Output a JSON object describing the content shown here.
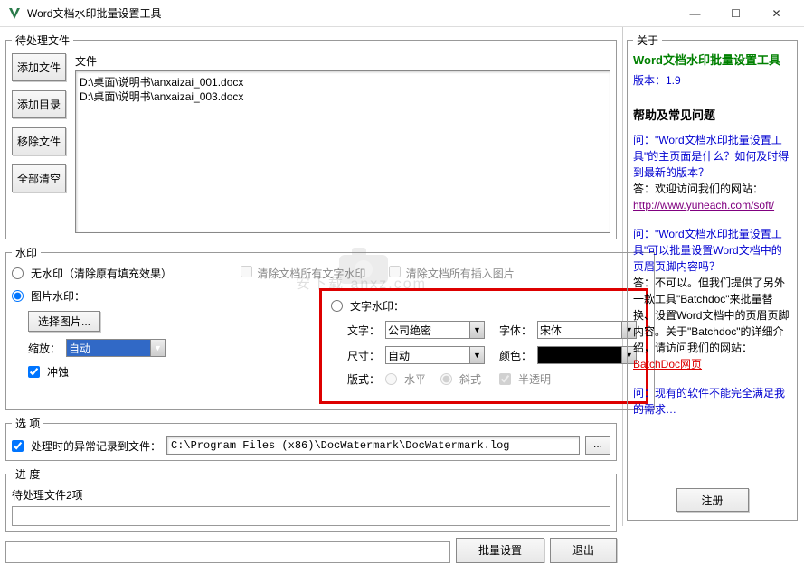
{
  "window": {
    "title": "Word文档水印批量设置工具",
    "min": "—",
    "max": "☐",
    "close": "✕"
  },
  "files_panel": {
    "legend": "待处理文件",
    "label": "文件",
    "add_file": "添加文件",
    "add_dir": "添加目录",
    "remove_file": "移除文件",
    "clear_all": "全部清空",
    "items": [
      "D:\\桌面\\说明书\\anxaizai_001.docx",
      "D:\\桌面\\说明书\\anxaizai_003.docx"
    ]
  },
  "watermark_panel": {
    "legend": "水印",
    "no_wm": "无水印（清除原有填充效果）",
    "clear_text": "清除文档所有文字水印",
    "clear_img": "清除文档所有插入图片",
    "pic_wm": "图片水印：",
    "select_pic": "选择图片...",
    "scale_label": "缩放：",
    "scale_value": "自动",
    "washout": "冲蚀",
    "text_wm": "文字水印：",
    "text_label": "文字：",
    "text_value": "公司绝密",
    "font_label": "字体：",
    "font_value": "宋体",
    "size_label": "尺寸：",
    "size_value": "自动",
    "color_label": "颜色：",
    "layout_label": "版式：",
    "layout_h": "水平",
    "layout_d": "斜式",
    "semitrans": "半透明"
  },
  "options_panel": {
    "legend": "选   项",
    "log_check": "处理时的异常记录到文件：",
    "log_path": "C:\\Program Files (x86)\\DocWatermark\\DocWatermark.log",
    "browse": "..."
  },
  "progress_panel": {
    "legend": "进   度",
    "status": "待处理文件2项"
  },
  "bottom": {
    "batch": "批量设置",
    "exit": "退出"
  },
  "about": {
    "legend": "关于",
    "title": "Word文档水印批量设置工具",
    "version": "版本：1.9",
    "help_title": "帮助及常见问题",
    "q1": "问：\"Word文档水印批量设置工具\"的主页面是什么？如何及时得到最新的版本？",
    "a1_prefix": "答：欢迎访问我们的网站：",
    "a1_link": "http://www.yuneach.com/soft/",
    "q2": "问：\"Word文档水印批量设置工具\"可以批量设置Word文档中的页眉页脚内容吗？",
    "a2": "答：不可以。但我们提供了另外一款工具\"Batchdoc\"来批量替换、设置Word文档中的页眉页脚内容。关于\"Batchdoc\"的详细介绍，请访问我们的网站：",
    "a2_link": "BatchDoc网页",
    "q3": "问：现有的软件不能完全满足我的需求…",
    "register": "注册"
  },
  "wm_site": "安下载 anxz.com"
}
